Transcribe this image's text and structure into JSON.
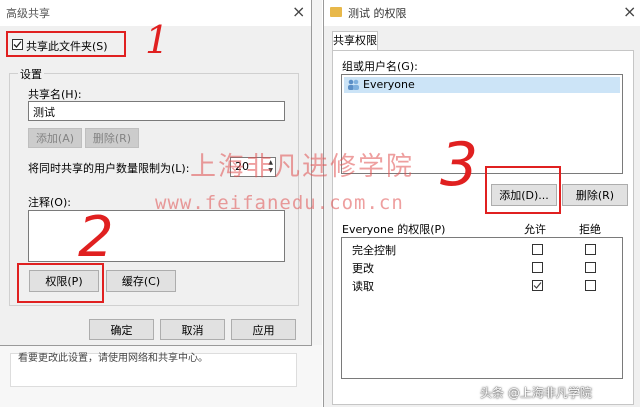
{
  "left_dialog": {
    "title": "高级共享",
    "close": "×",
    "share_checkbox_label": "共享此文件夹(S)",
    "group_label": "设置",
    "share_name_label": "共享名(H):",
    "share_name_value": "测试",
    "add_button": "添加(A)",
    "remove_button": "删除(R)",
    "limit_label": "将同时共享的用户数量限制为(L):",
    "limit_value": "20",
    "comment_label": "注释(O):",
    "permissions_button": "权限(P)",
    "cache_button": "缓存(C)",
    "ok_button": "确定",
    "cancel_button": "取消",
    "apply_button": "应用",
    "background_link": "看要更改此设置，请使用网络和共享中心。"
  },
  "right_dialog": {
    "title": "测试 的权限",
    "close": "×",
    "tab_label": "共享权限",
    "users_label": "组或用户名(G):",
    "users": [
      "Everyone"
    ],
    "add_button": "添加(D)...",
    "remove_button": "删除(R)",
    "permissions_header": "Everyone 的权限(P)",
    "allow_header": "允许",
    "deny_header": "拒绝",
    "permissions": [
      {
        "name": "完全控制",
        "allow": false,
        "deny": false
      },
      {
        "name": "更改",
        "allow": false,
        "deny": false
      },
      {
        "name": "读取",
        "allow": true,
        "deny": false
      }
    ]
  },
  "annotations": {
    "num1": "1",
    "num2": "2",
    "num3": "3",
    "accent_color": "#e02020"
  },
  "watermark": {
    "line1": "上海非凡进修学院",
    "line2": "www.feifanedu.com.cn",
    "footer": "头条 @上海非凡学院"
  }
}
